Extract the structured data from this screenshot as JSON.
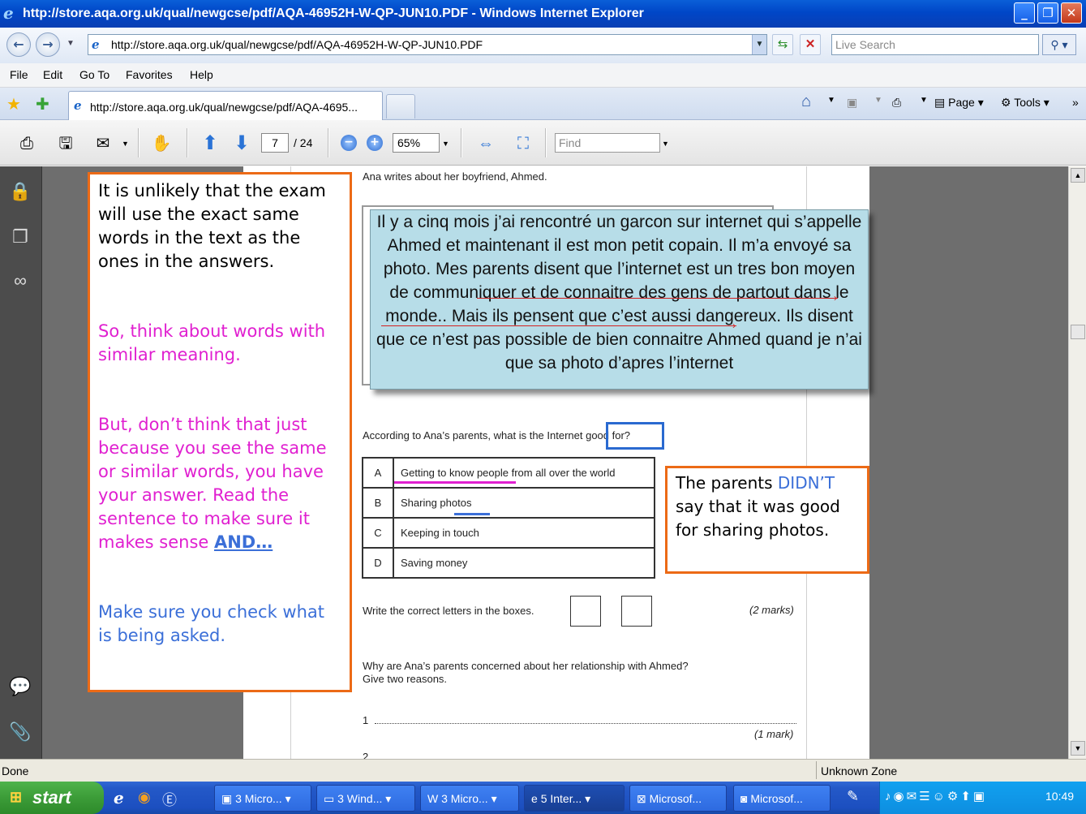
{
  "window": {
    "title": "http://store.aqa.org.uk/qual/newgcse/pdf/AQA-46952H-W-QP-JUN10.PDF - Windows Internet Explorer"
  },
  "address": {
    "url": "http://store.aqa.org.uk/qual/newgcse/pdf/AQA-46952H-W-QP-JUN10.PDF",
    "search_placeholder": "Live Search"
  },
  "menu": [
    "File",
    "Edit",
    "Go To",
    "Favorites",
    "Help"
  ],
  "tab": {
    "label": "http://store.aqa.org.uk/qual/newgcse/pdf/AQA-4695...",
    "page_label": "Page",
    "tools_label": "Tools"
  },
  "pdf_toolbar": {
    "page_current": "7",
    "page_total": "/ 24",
    "zoom": "65%",
    "find_placeholder": "Find"
  },
  "pdf": {
    "intro": "Ana writes about her boyfriend, Ahmed.",
    "passage": "Il y a cinq mois j’ai rencontré un garcon sur internet qui s’appelle Ahmed et maintenant il est mon petit copain. Il m’a envoyé sa photo. Mes parents disent que l’internet est un tres bon moyen de communiquer et de connaitre des gens de partout dans le monde.. Mais ils pensent que c’est aussi dangereux. Ils disent que ce n’est pas possible de bien connaitre Ahmed quand je n’ai que sa photo d’apres l’internet",
    "question1": "According to Ana’s parents, what is the Internet good for?",
    "options": [
      {
        "letter": "A",
        "text": "Getting to know people from all over the world"
      },
      {
        "letter": "B",
        "text": "Sharing photos"
      },
      {
        "letter": "C",
        "text": "Keeping in touch"
      },
      {
        "letter": "D",
        "text": "Saving money"
      }
    ],
    "instruction": "Write the correct letters in the boxes.",
    "marks1": "(2 marks)",
    "question2_line1": "Why are Ana’s parents concerned about her relationship with Ahmed?",
    "question2_line2": "Give two reasons.",
    "answer_line_number": "1",
    "marks2": "(1 mark)"
  },
  "left_note": {
    "p1": "It is unlikely that the exam will use the exact same words in the text as the ones in the answers.",
    "p2": "So, think about words with similar meaning.",
    "p3": "But, don’t think that  just because you see the same or similar words, you have your answer. Read the sentence to make sure it makes sense ",
    "p3_link": "AND…",
    "p4": "Make sure you check what is being asked."
  },
  "right_note": {
    "pre": "The parents ",
    "highlight": "DIDN’T",
    "post": " say that it was good for sharing photos."
  },
  "status": {
    "left": "Done",
    "zone": "Unknown Zone"
  },
  "taskbar": {
    "start": "start",
    "tasks": [
      "3 Micro...",
      "3 Wind...",
      "3 Micro...",
      "5 Inter...",
      "Microsof...",
      "Microsof..."
    ],
    "clock": "10:49"
  },
  "colors": {
    "annotation_border": "#ec6a16",
    "magenta_text": "#e020d0",
    "blue_text": "#3b6fd8",
    "passage_bg": "#b7dde8"
  }
}
